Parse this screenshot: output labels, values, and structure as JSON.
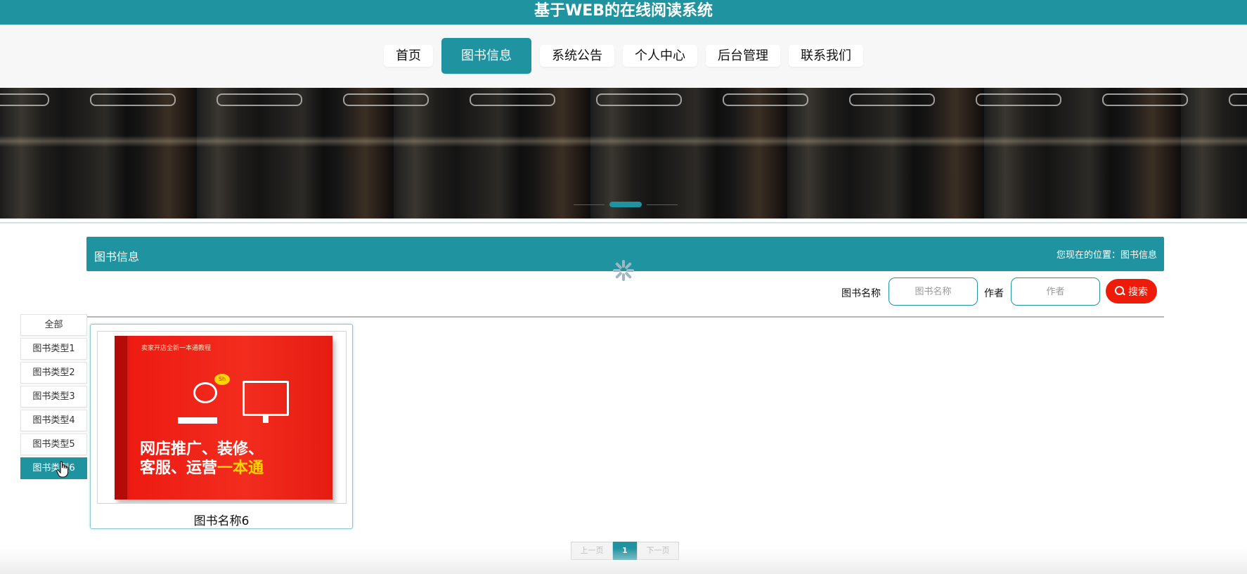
{
  "site": {
    "title": "基于WEB的在线阅读系统"
  },
  "nav": {
    "items": [
      {
        "label": "首页",
        "active": false
      },
      {
        "label": "图书信息",
        "active": true
      },
      {
        "label": "系统公告",
        "active": false
      },
      {
        "label": "个人中心",
        "active": false
      },
      {
        "label": "后台管理",
        "active": false
      },
      {
        "label": "联系我们",
        "active": false
      }
    ]
  },
  "banner": {
    "slides": 3,
    "active_slide": 2
  },
  "section": {
    "title": "图书信息",
    "breadcrumb": "您现在的位置：图书信息"
  },
  "search": {
    "name_label": "图书名称",
    "name_placeholder": "图书名称",
    "author_label": "作者",
    "author_placeholder": "作者",
    "button_label": "搜索"
  },
  "categories": {
    "items": [
      {
        "label": "全部",
        "active": false
      },
      {
        "label": "图书类型1",
        "active": false
      },
      {
        "label": "图书类型2",
        "active": false
      },
      {
        "label": "图书类型3",
        "active": false
      },
      {
        "label": "图书类型4",
        "active": false
      },
      {
        "label": "图书类型5",
        "active": false
      },
      {
        "label": "图书类型6",
        "active": true
      }
    ]
  },
  "books": [
    {
      "name": "图书名称6",
      "cover": {
        "top_text": "卖家开店全新一本通教程",
        "title_line1": "网店推广、装修、",
        "title_line2": "客服、运营",
        "title_highlight": "一本通",
        "badge": "Sh"
      }
    }
  ],
  "pagination": {
    "prev_label": "上一页",
    "current_page": "1",
    "next_label": "下一页"
  },
  "colors": {
    "accent": "#1f93a0",
    "search_button": "#ef1b09",
    "book_red": "#ee1b12",
    "highlight": "#ffd400"
  }
}
